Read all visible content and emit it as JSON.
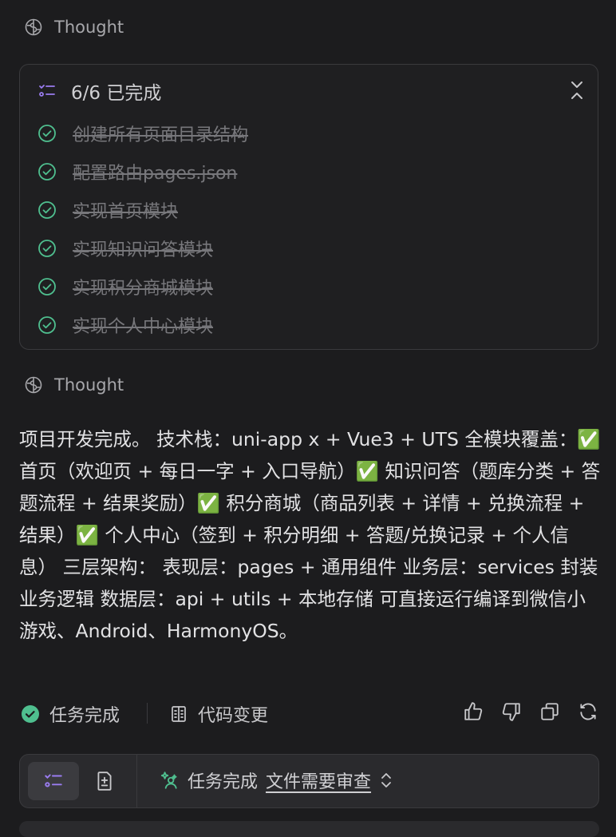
{
  "thought_label": "Thought",
  "todo": {
    "summary": "6/6 已完成",
    "items": [
      {
        "label": "创建所有页面目录结构"
      },
      {
        "label": "配置路由pages.json"
      },
      {
        "label": "实现首页模块"
      },
      {
        "label": "实现知识问答模块"
      },
      {
        "label": "实现积分商城模块"
      },
      {
        "label": "实现个人中心模块"
      }
    ]
  },
  "message": "项目开发完成。 技术栈：uni-app x + Vue3 + UTS 全模块覆盖：✅ 首页（欢迎页 + 每日一字 + 入口导航）✅ 知识问答（题库分类 + 答题流程 + 结果奖励）✅ 积分商城（商品列表 + 详情 + 兑换流程 + 结果）✅ 个人中心（签到 + 积分明细 + 答题/兑换记录 + 个人信息） 三层架构： 表现层：pages + 通用组件 业务层：services 封装业务逻辑 数据层：api + utils + 本地存储 可直接运行编译到微信小游戏、Android、HarmonyOS。",
  "actions": {
    "status_label": "任务完成",
    "diff_label": "代码变更"
  },
  "bottom_bar": {
    "status": "任务完成",
    "review_link": "文件需要审查"
  },
  "colors": {
    "check": "#4fbf8f",
    "accent_purple": "#9a7cf0",
    "sparkle_green": "#4fbf8f"
  }
}
